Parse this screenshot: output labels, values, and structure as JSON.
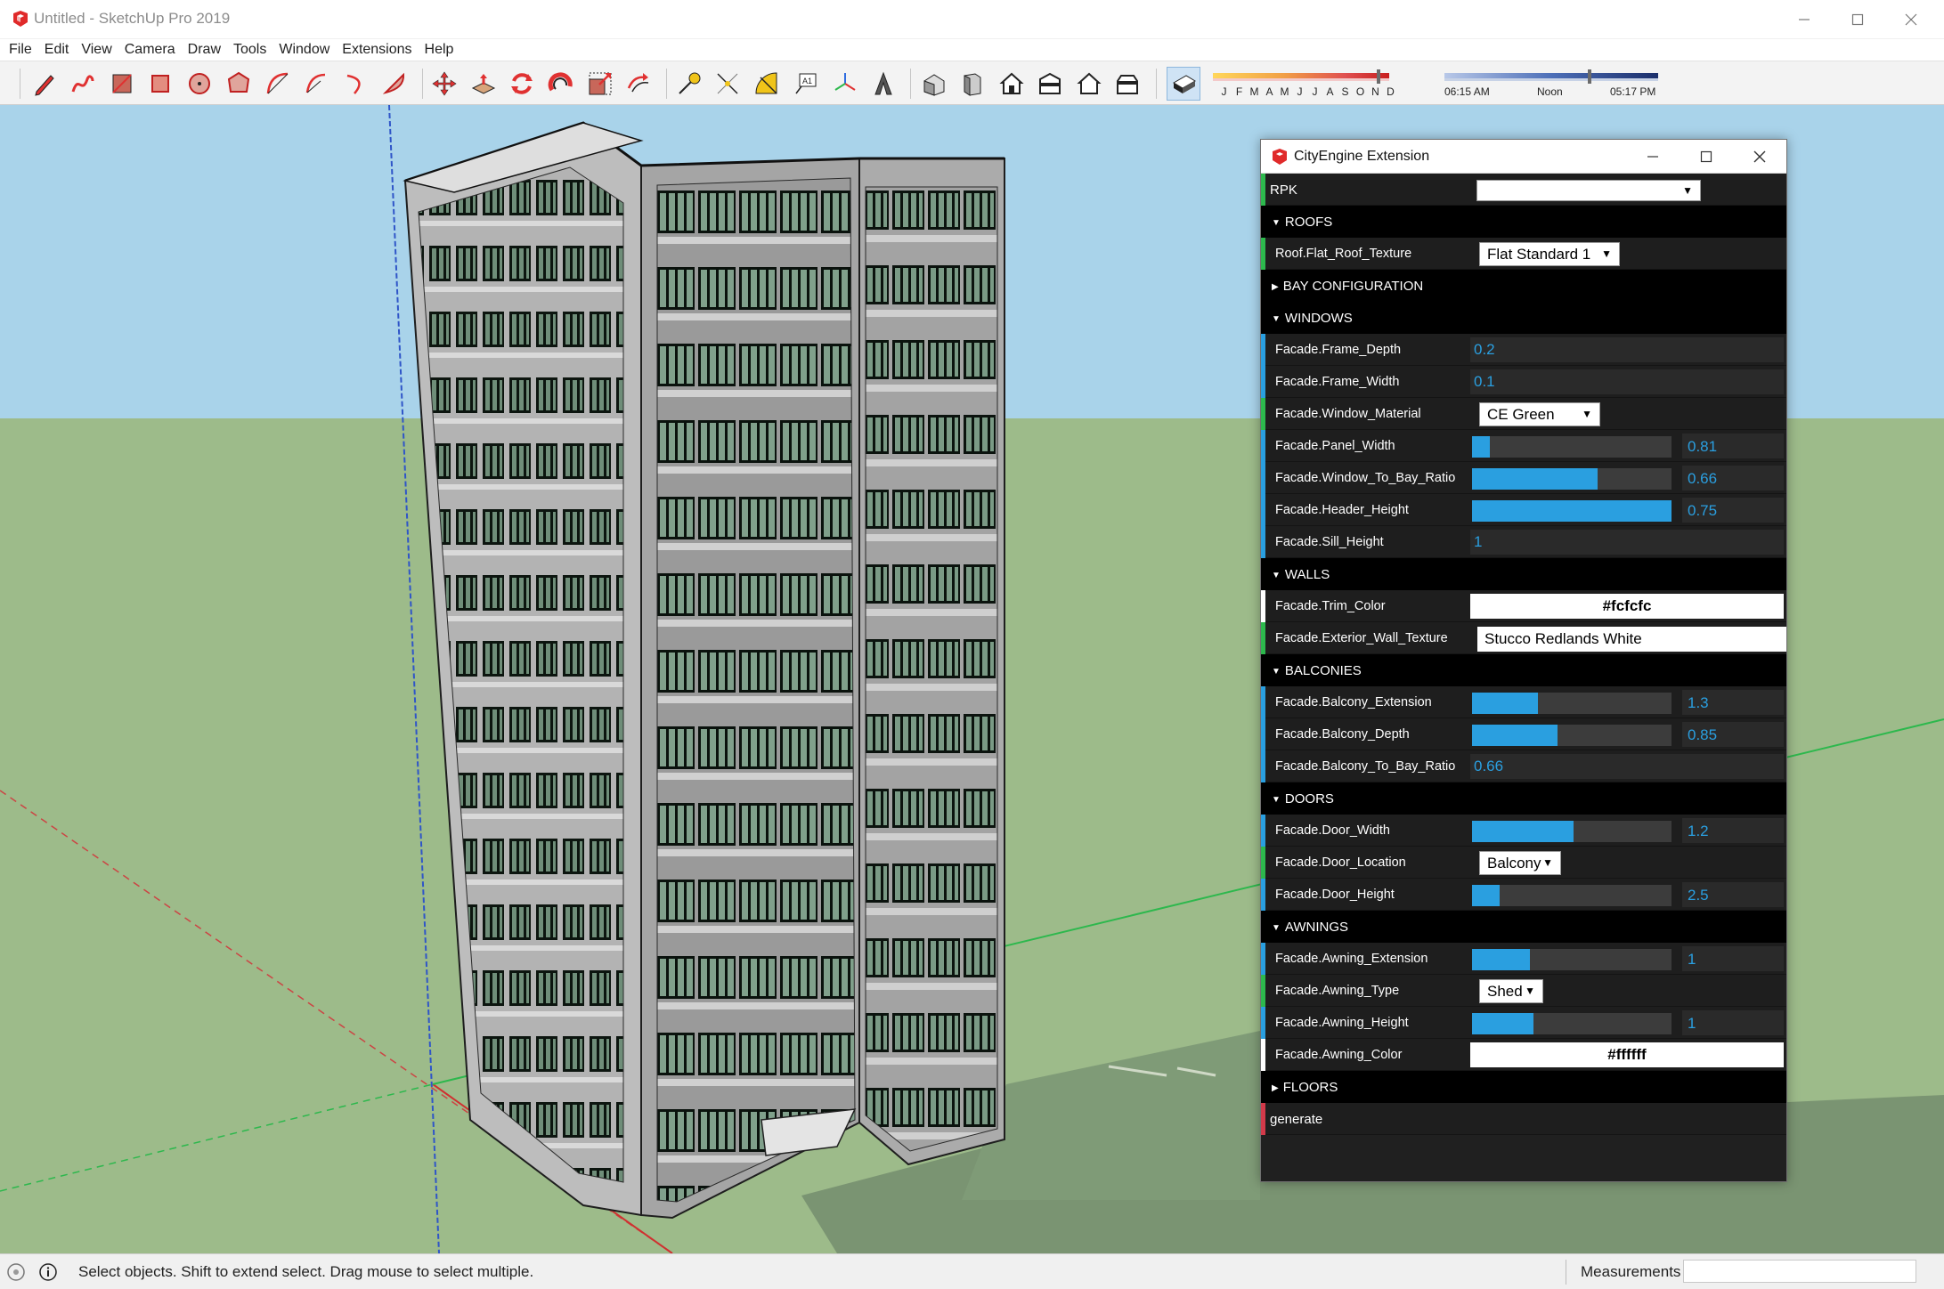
{
  "window": {
    "title": "Untitled - SketchUp Pro 2019"
  },
  "menu": [
    "File",
    "Edit",
    "View",
    "Camera",
    "Draw",
    "Tools",
    "Window",
    "Extensions",
    "Help"
  ],
  "shadow": {
    "months": [
      "J",
      "F",
      "M",
      "A",
      "M",
      "J",
      "J",
      "A",
      "S",
      "O",
      "N",
      "D"
    ],
    "time_start": "06:15 AM",
    "time_mid": "Noon",
    "time_end": "05:17 PM"
  },
  "status": {
    "hint": "Select objects. Shift to extend select. Drag mouse to select multiple.",
    "measurements_label": "Measurements"
  },
  "colors": {
    "sky": "#a9d3ea",
    "ground": "#9dbb8a",
    "accent_blue": "#2a9fe0",
    "accent_green": "#2db84d",
    "accent_red": "#d23a4a"
  },
  "cityengine": {
    "title": "CityEngine Extension",
    "rpk_label": "RPK",
    "roofs": "ROOFS",
    "roof_texture": {
      "label": "Roof.Flat_Roof_Texture",
      "value": "Flat Standard 1"
    },
    "bay_configuration": "BAY CONFIGURATION",
    "windows": "WINDOWS",
    "frame_depth": {
      "label": "Facade.Frame_Depth",
      "value": "0.2"
    },
    "frame_width": {
      "label": "Facade.Frame_Width",
      "value": "0.1"
    },
    "window_material": {
      "label": "Facade.Window_Material",
      "value": "CE Green"
    },
    "panel_width": {
      "label": "Facade.Panel_Width",
      "value": "0.81",
      "fill": 0.09
    },
    "window_to_bay_ratio": {
      "label": "Facade.Window_To_Bay_Ratio",
      "value": "0.66",
      "fill": 0.63
    },
    "header_height": {
      "label": "Facade.Header_Height",
      "value": "0.75",
      "fill": 1.0
    },
    "sill_height": {
      "label": "Facade.Sill_Height",
      "value": "1"
    },
    "walls": "WALLS",
    "trim_color": {
      "label": "Facade.Trim_Color",
      "value": "#fcfcfc"
    },
    "exterior_wall_texture": {
      "label": "Facade.Exterior_Wall_Texture",
      "value": "Stucco Redlands White"
    },
    "balconies": "BALCONIES",
    "balcony_extension": {
      "label": "Facade.Balcony_Extension",
      "value": "1.3",
      "fill": 0.33
    },
    "balcony_depth": {
      "label": "Facade.Balcony_Depth",
      "value": "0.85",
      "fill": 0.43
    },
    "balcony_to_bay_ratio": {
      "label": "Facade.Balcony_To_Bay_Ratio",
      "value": "0.66"
    },
    "doors": "DOORS",
    "door_width": {
      "label": "Facade.Door_Width",
      "value": "1.2",
      "fill": 0.51
    },
    "door_location": {
      "label": "Facade.Door_Location",
      "value": "Balcony"
    },
    "door_height": {
      "label": "Facade.Door_Height",
      "value": "2.5",
      "fill": 0.14
    },
    "awnings": "AWNINGS",
    "awning_extension": {
      "label": "Facade.Awning_Extension",
      "value": "1",
      "fill": 0.29
    },
    "awning_type": {
      "label": "Facade.Awning_Type",
      "value": "Shed"
    },
    "awning_height": {
      "label": "Facade.Awning_Height",
      "value": "1",
      "fill": 0.31
    },
    "awning_color": {
      "label": "Facade.Awning_Color",
      "value": "#ffffff"
    },
    "floors": "FLOORS",
    "generate": "generate"
  }
}
